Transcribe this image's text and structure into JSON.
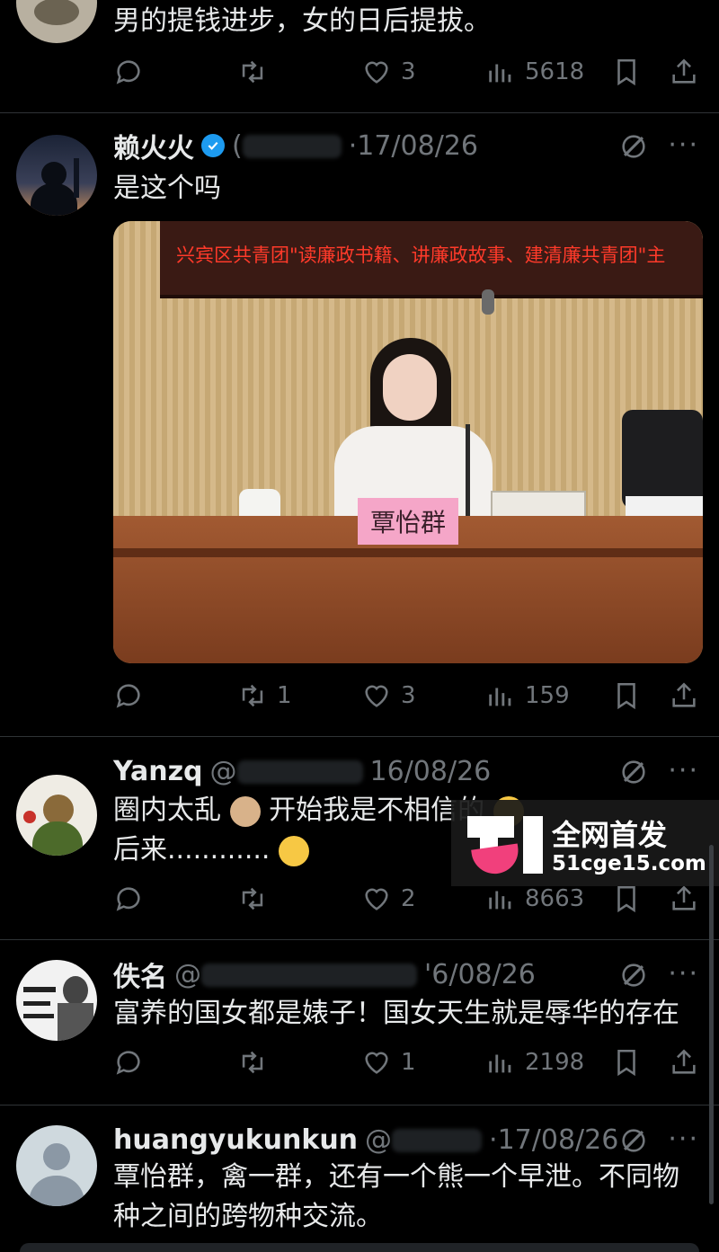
{
  "colors": {
    "background": "#000000",
    "text": "#e7e9ea",
    "muted": "#71767b",
    "accent": "#1d9bf0",
    "divider": "#2f3336"
  },
  "icons": [
    "reply-icon",
    "retweet-icon",
    "like-icon",
    "views-icon",
    "bookmark-icon",
    "share-icon",
    "grok-icon",
    "more-icon",
    "verified-badge-icon"
  ],
  "post1": {
    "text": "男的提钱进步，女的日后提拔。",
    "likes": "3",
    "views": "5618"
  },
  "post2": {
    "name": "赖火火",
    "handle_prefix": "(",
    "date": "·17/08/26",
    "text": "是这个吗",
    "photo": {
      "banner": "兴宾区共青团\"读廉政书籍、讲廉政故事、建清廉共青团\"主",
      "nameplate": "覃怡群"
    },
    "retweets": "1",
    "likes": "3",
    "views": "159"
  },
  "post3": {
    "name": "Yanzq",
    "handle_prefix": "@",
    "date": "16/08/26",
    "text_line1_a": "圈内太乱",
    "text_line1_b": "开始我是不相信的",
    "text_line2": "后来............",
    "likes": "2",
    "views": "8663"
  },
  "post4": {
    "name": "佚名",
    "handle_prefix": "@",
    "date": "'6/08/26",
    "text": "富养的国女都是婊子！国女天生就是辱华的存在",
    "likes": "1",
    "views": "2198"
  },
  "post5": {
    "name": "huangyukunkun",
    "handle_prefix": "@",
    "date": "·17/08/26",
    "text": "覃怡群，禽一群，还有一个熊一个早泄。不同物种之间的跨物种交流。"
  },
  "watermark": {
    "logo": "51",
    "title": "全网首发",
    "domain": "51cge15.com"
  }
}
